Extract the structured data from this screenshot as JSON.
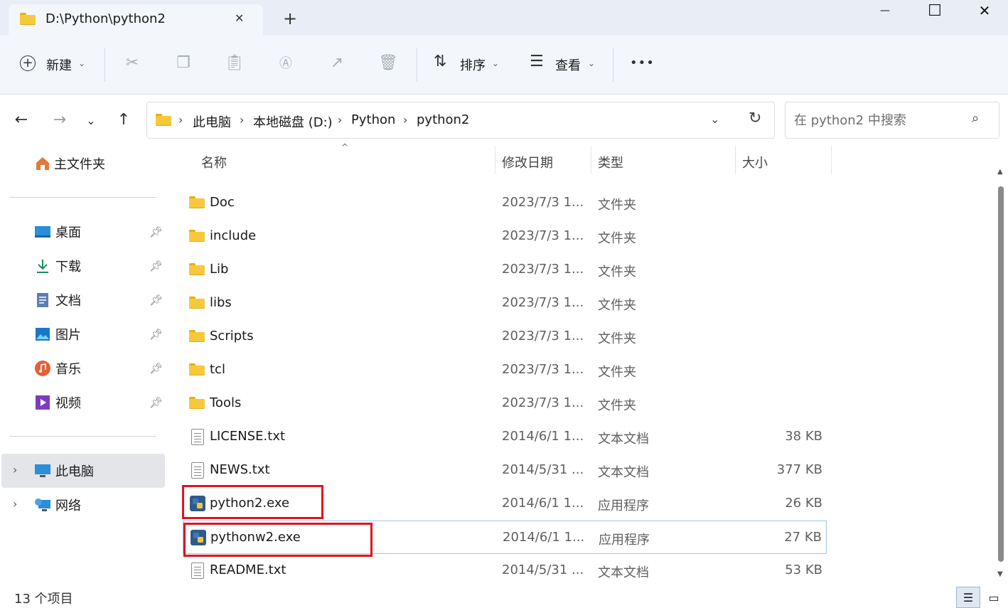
{
  "window": {
    "tab_title": "D:\\Python\\python2",
    "new_tab": "+",
    "close_tab": "✕",
    "minimize": "—",
    "maximize": "☐",
    "close": "✕"
  },
  "toolbar": {
    "new_label": "新建",
    "sort_label": "排序",
    "view_label": "查看",
    "more": "•••"
  },
  "address": {
    "crumbs": [
      "此电脑",
      "本地磁盘 (D:)",
      "Python",
      "python2"
    ],
    "search_placeholder": "在 python2 中搜索"
  },
  "sidebar": {
    "home": "主文件夹",
    "pinned": [
      "桌面",
      "下载",
      "文档",
      "图片",
      "音乐",
      "视频"
    ],
    "this_pc": "此电脑",
    "network": "网络"
  },
  "columns": {
    "name": "名称",
    "modified": "修改日期",
    "type": "类型",
    "size": "大小"
  },
  "files": [
    {
      "name": "Doc",
      "date": "2023/7/3 1...",
      "type": "文件夹",
      "size": ""
    },
    {
      "name": "include",
      "date": "2023/7/3 1...",
      "type": "文件夹",
      "size": ""
    },
    {
      "name": "Lib",
      "date": "2023/7/3 1...",
      "type": "文件夹",
      "size": ""
    },
    {
      "name": "libs",
      "date": "2023/7/3 1...",
      "type": "文件夹",
      "size": ""
    },
    {
      "name": "Scripts",
      "date": "2023/7/3 1...",
      "type": "文件夹",
      "size": ""
    },
    {
      "name": "tcl",
      "date": "2023/7/3 1...",
      "type": "文件夹",
      "size": ""
    },
    {
      "name": "Tools",
      "date": "2023/7/3 1...",
      "type": "文件夹",
      "size": ""
    },
    {
      "name": "LICENSE.txt",
      "date": "2014/6/1 1...",
      "type": "文本文档",
      "size": "38 KB"
    },
    {
      "name": "NEWS.txt",
      "date": "2014/5/31 ...",
      "type": "文本文档",
      "size": "377 KB"
    },
    {
      "name": "python2.exe",
      "date": "2014/6/1 1...",
      "type": "应用程序",
      "size": "26 KB"
    },
    {
      "name": "pythonw2.exe",
      "date": "2014/6/1 1...",
      "type": "应用程序",
      "size": "27 KB"
    },
    {
      "name": "README.txt",
      "date": "2014/5/31 ...",
      "type": "文本文档",
      "size": "53 KB"
    }
  ],
  "status": {
    "item_count": "13 个项目"
  },
  "colors": {
    "highlight_box": "#e0141e",
    "accent": "#0067c0"
  }
}
